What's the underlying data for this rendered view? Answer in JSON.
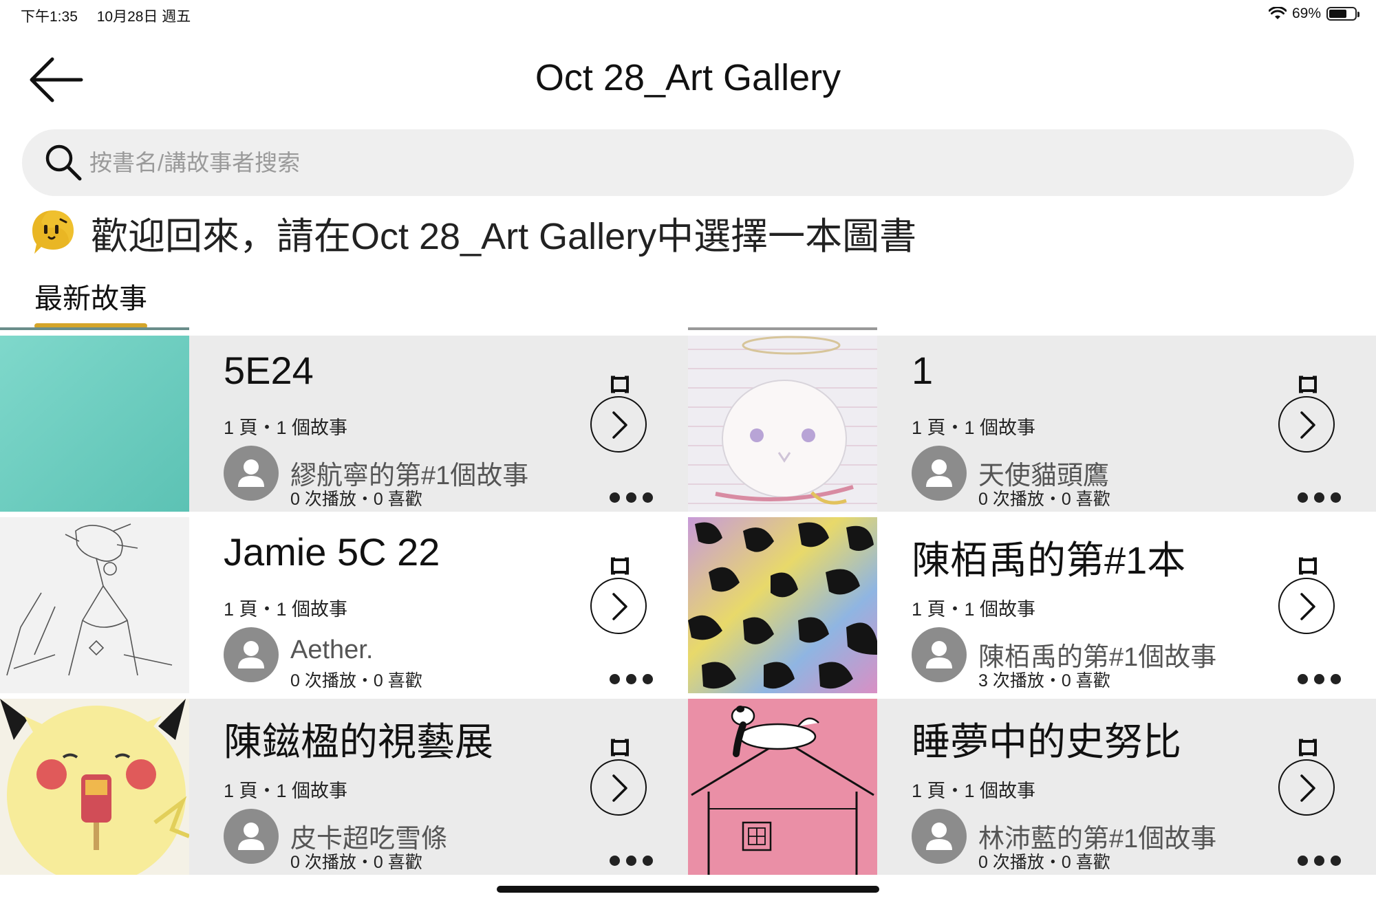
{
  "status_bar": {
    "time": "下午1:35",
    "date": "10月28日 週五",
    "battery": "69%",
    "battery_level": 0.69
  },
  "header": {
    "title": "Oct 28_Art Gallery"
  },
  "search": {
    "placeholder": "按書名/講故事者搜索"
  },
  "welcome": {
    "text": "歡迎回來，請在Oct 28_Art Gallery中選擇一本圖書"
  },
  "tabs": {
    "latest": "最新故事"
  },
  "books": [
    {
      "title": "5E24",
      "meta": "1 頁・1 個故事",
      "author": "繆航寧的第#1個故事",
      "stats": "0 次播放・0 喜歡"
    },
    {
      "title": "1",
      "meta": "1 頁・1 個故事",
      "author": "天使貓頭鷹",
      "stats": "0 次播放・0 喜歡"
    },
    {
      "title": "Jamie 5C 22",
      "meta": "1 頁・1 個故事",
      "author": "Aether.",
      "stats": "0 次播放・0 喜歡"
    },
    {
      "title": "陳栢禹的第#1本",
      "meta": "1 頁・1 個故事",
      "author": "陳栢禹的第#1個故事",
      "stats": "3 次播放・0 喜歡"
    },
    {
      "title": "陳鎡楹的視藝展",
      "meta": "1 頁・1 個故事",
      "author": "皮卡超吃雪條",
      "stats": "0 次播放・0 喜歡"
    },
    {
      "title": "睡夢中的史努比",
      "meta": "1 頁・1 個故事",
      "author": "林沛藍的第#1個故事",
      "stats": "0 次播放・0 喜歡"
    }
  ],
  "colors": {
    "accent": "#d4a52a",
    "row_grey": "#ebebeb",
    "search_bg": "#efefef",
    "avatar_grey": "#8c8c8c"
  }
}
